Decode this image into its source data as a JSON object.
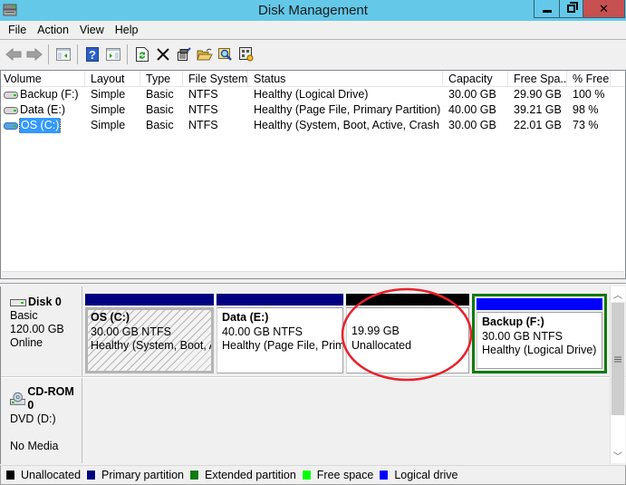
{
  "window": {
    "title": "Disk Management",
    "controls": [
      "minimize",
      "restore",
      "close"
    ]
  },
  "menu": [
    "File",
    "Action",
    "View",
    "Help"
  ],
  "toolbar": {
    "buttons": [
      {
        "icon": "back-arrow-icon"
      },
      {
        "icon": "forward-arrow-icon"
      },
      {
        "icon": "show-hide-console-tree-icon"
      },
      {
        "icon": "help-icon"
      },
      {
        "icon": "show-hide-action-pane-icon"
      },
      {
        "icon": "refresh-icon"
      },
      {
        "icon": "delete-icon"
      },
      {
        "icon": "properties-icon"
      },
      {
        "icon": "open-folder-icon"
      },
      {
        "icon": "explore-icon"
      },
      {
        "icon": "settings-icon"
      }
    ]
  },
  "volume_list": {
    "columns": [
      "Volume",
      "Layout",
      "Type",
      "File System",
      "Status",
      "Capacity",
      "Free Spa...",
      "% Free"
    ],
    "rows": [
      {
        "volume": "Backup (F:)",
        "layout": "Simple",
        "type": "Basic",
        "fs": "NTFS",
        "status": "Healthy (Logical Drive)",
        "capacity": "30.00 GB",
        "free": "29.90 GB",
        "pct": "100 %",
        "selected": false
      },
      {
        "volume": "Data (E:)",
        "layout": "Simple",
        "type": "Basic",
        "fs": "NTFS",
        "status": "Healthy (Page File, Primary Partition)",
        "capacity": "40.00 GB",
        "free": "39.21 GB",
        "pct": "98 %",
        "selected": false
      },
      {
        "volume": "OS (C:)",
        "layout": "Simple",
        "type": "Basic",
        "fs": "NTFS",
        "status": "Healthy (System, Boot, Active, Crash ...",
        "capacity": "30.00 GB",
        "free": "22.01 GB",
        "pct": "73 %",
        "selected": true
      }
    ]
  },
  "disks": [
    {
      "name": "Disk 0",
      "type": "Basic",
      "size": "120.00 GB",
      "state": "Online",
      "partitions": [
        {
          "name": "OS  (C:)",
          "size": "30.00 GB NTFS",
          "status": "Healthy (System, Boot, A",
          "kind": "Primary partition",
          "bar_color": "#00007f",
          "selected": true
        },
        {
          "name": "Data  (E:)",
          "size": "40.00 GB NTFS",
          "status": "Healthy (Page File, Prima",
          "kind": "Primary partition",
          "bar_color": "#00007f",
          "selected": false
        },
        {
          "name": "",
          "size": "19.99 GB",
          "status": "Unallocated",
          "kind": "Unallocated",
          "bar_color": "#000000",
          "selected": false,
          "highlighted": true
        },
        {
          "name": "Backup  (F:)",
          "size": "30.00 GB NTFS",
          "status": "Healthy (Logical Drive)",
          "kind": "Logical drive",
          "bar_color": "#0000ff",
          "selected": false,
          "extended_border_color": "#107b10"
        }
      ]
    },
    {
      "name": "CD-ROM 0",
      "type": "DVD (D:)",
      "size": "",
      "state": "No Media",
      "partitions": []
    }
  ],
  "legend": [
    {
      "label": "Unallocated",
      "color": "#000000"
    },
    {
      "label": "Primary partition",
      "color": "#00007f"
    },
    {
      "label": "Extended partition",
      "color": "#107b10"
    },
    {
      "label": "Free space",
      "color": "#00ff00"
    },
    {
      "label": "Logical drive",
      "color": "#0000ff"
    }
  ],
  "annotation": {
    "shape": "ellipse",
    "color": "#e8202a",
    "target": "Unallocated 19.99 GB"
  }
}
